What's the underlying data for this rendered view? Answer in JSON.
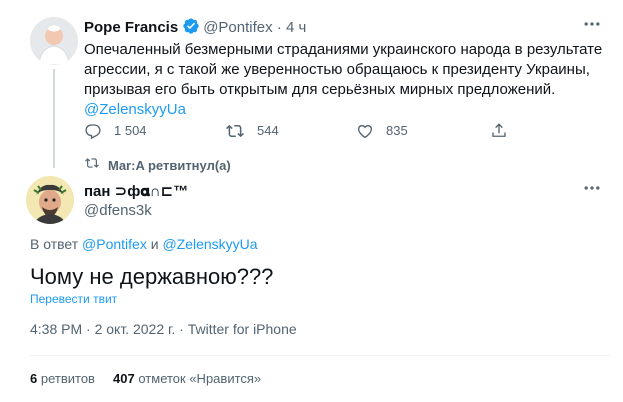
{
  "parent_tweet": {
    "author_name": "Pope Francis",
    "handle": "@Pontifex",
    "separator": "·",
    "time": "4 ч",
    "more_icon": "more-horizontal-icon",
    "text": "Опечаленный безмерными страданиями украинского народа в результате агрессии, я с такой же уверенностью обращаюсь к президенту Украины, призывая его быть открытым для серьёзных мирных предложений.",
    "mention": "@ZelenskyyUa",
    "replies": "1 504",
    "retweets": "544",
    "likes": "835"
  },
  "retweet_notice": {
    "text": "Mar:A ретвитнул(а)"
  },
  "main_tweet": {
    "author_name": "пан ⊃ф𝛂∩⊏™",
    "handle": "@dfens3k",
    "reply_prefix": "В ответ",
    "reply_user1": "@Pontifex",
    "reply_and": "и",
    "reply_user2": "@ZelenskyyUa",
    "text": "Чому не державною???",
    "translate_label": "Перевести твит",
    "meta": "4:38 PM · 2 окт. 2022 г. · Twitter for iPhone",
    "retweets_count": "6",
    "retweets_label": "ретвитов",
    "likes_count": "407",
    "likes_label": "отметок «Нравится»"
  },
  "colors": {
    "accent": "#1d9bf0",
    "secondary_text": "#536471",
    "primary_text": "#0f1419",
    "divider": "#eff3f4"
  }
}
